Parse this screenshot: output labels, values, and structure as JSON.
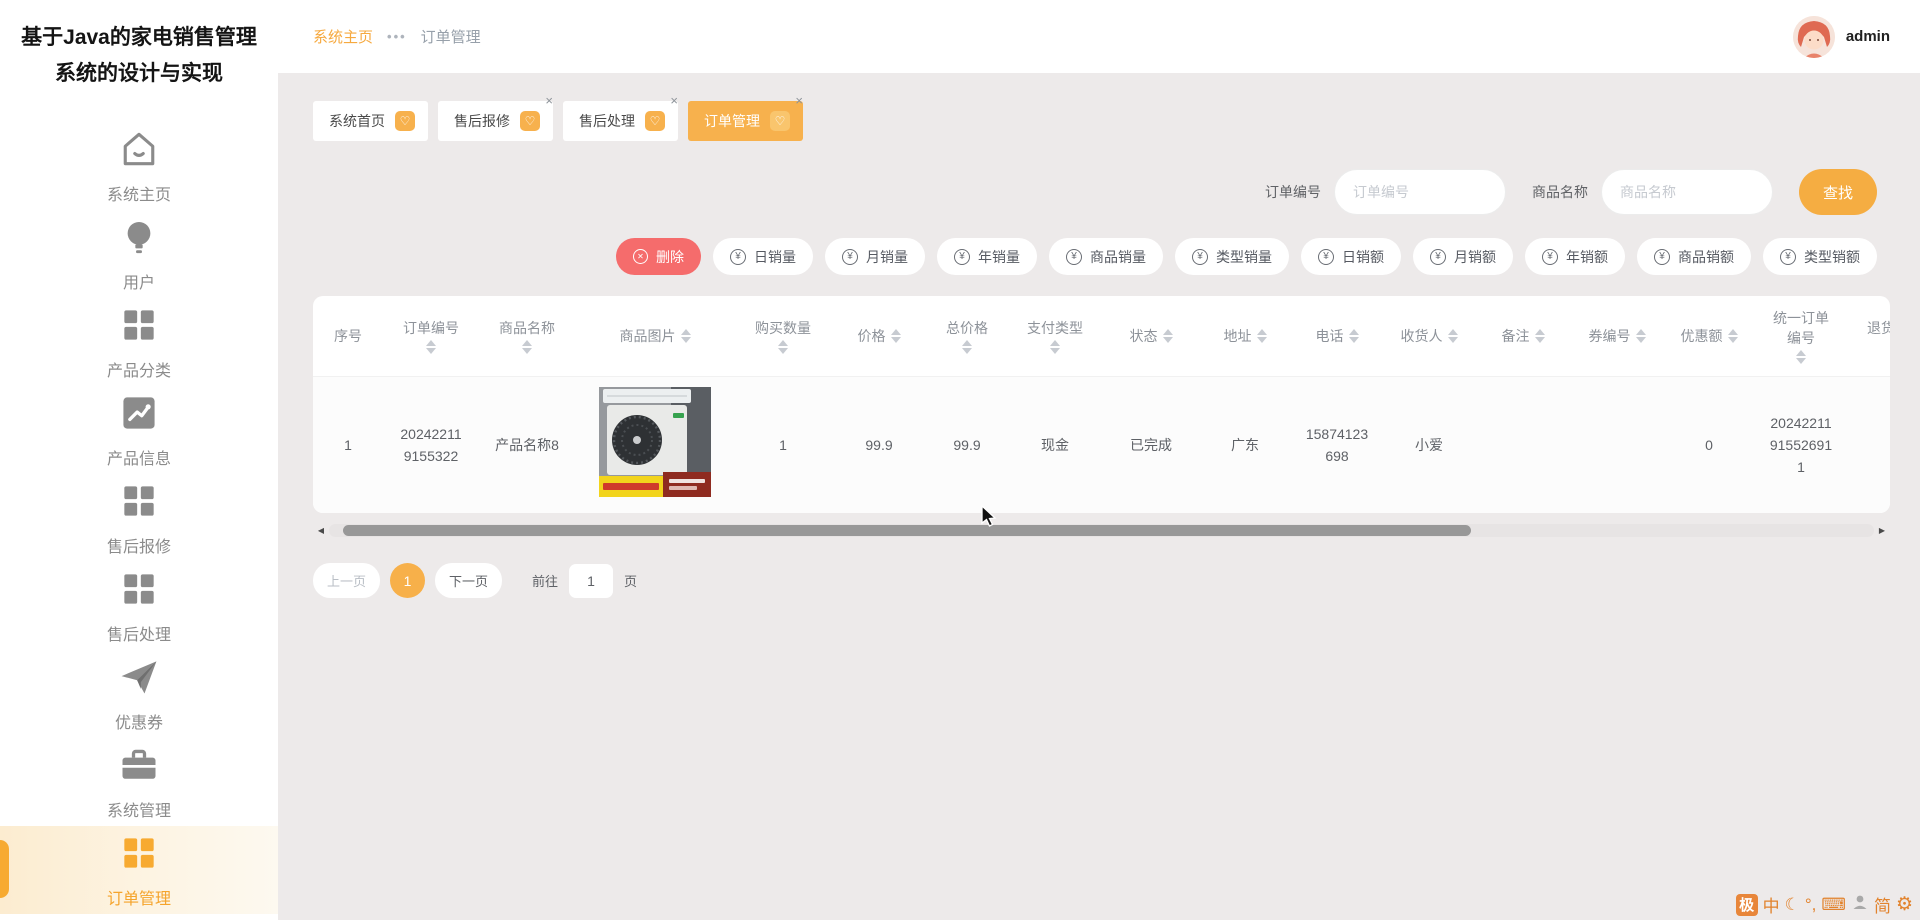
{
  "app": {
    "title_line1": "基于Java的家电销售管理",
    "title_line2": "系统的设计与实现",
    "user_name": "admin"
  },
  "breadcrumb": {
    "home": "系统主页",
    "dots": "•••",
    "current": "订单管理"
  },
  "sidebar": {
    "items": [
      {
        "label": "系统主页",
        "icon": "home-icon"
      },
      {
        "label": "用户",
        "icon": "bulb-icon"
      },
      {
        "label": "产品分类",
        "icon": "grid-icon"
      },
      {
        "label": "产品信息",
        "icon": "chart-icon"
      },
      {
        "label": "售后报修",
        "icon": "grid-icon"
      },
      {
        "label": "售后处理",
        "icon": "grid-icon"
      },
      {
        "label": "优惠券",
        "icon": "paper-plane-icon"
      },
      {
        "label": "系统管理",
        "icon": "briefcase-icon"
      },
      {
        "label": "订单管理",
        "icon": "grid-icon"
      }
    ]
  },
  "tabs": [
    {
      "label": "系统首页"
    },
    {
      "label": "售后报修"
    },
    {
      "label": "售后处理"
    },
    {
      "label": "订单管理"
    }
  ],
  "ui": {
    "close": "×",
    "badge_glyph": "♡",
    "yen": "¥",
    "delete_glyph": "✕",
    "scroll_left": "◀",
    "scroll_right": "▶"
  },
  "search": {
    "order_label": "订单编号",
    "order_placeholder": "订单编号",
    "product_label": "商品名称",
    "product_placeholder": "商品名称",
    "button": "查找"
  },
  "actions": {
    "delete": "删除",
    "buttons": [
      "日销量",
      "月销量",
      "年销量",
      "商品销量",
      "类型销量",
      "日销额",
      "月销额",
      "年销额",
      "商品销额",
      "类型销额"
    ]
  },
  "table": {
    "columns": [
      "序号",
      "订单编号",
      "商品名称",
      "商品图片",
      "购买数量",
      "价格",
      "总价格",
      "支付类型",
      "状态",
      "地址",
      "电话",
      "收货人",
      "备注",
      "券编号",
      "优惠额",
      "统一订单编号",
      "退货状态"
    ],
    "row_cells": [
      "1",
      "202422119155322",
      "产品名称8",
      "",
      "1",
      "99.9",
      "99.9",
      "现金",
      "已完成",
      "广东",
      "15874123698",
      "小爱",
      "",
      "",
      "0",
      "20242211915526911",
      ""
    ]
  },
  "pagination": {
    "prev": "上一页",
    "page": "1",
    "next": "下一页",
    "goto": "前往",
    "page_value": "1",
    "unit": "页"
  },
  "ime": {
    "items": [
      "极",
      "中",
      "☾",
      "°,",
      "⌨",
      "简",
      "⚙"
    ]
  },
  "colors": {
    "accent": "#f7b14d",
    "breadcrumb_accent": "#f6a93f",
    "danger": "#f56c6c",
    "header_text": "#8d9299",
    "cell_text": "#5e6166"
  }
}
